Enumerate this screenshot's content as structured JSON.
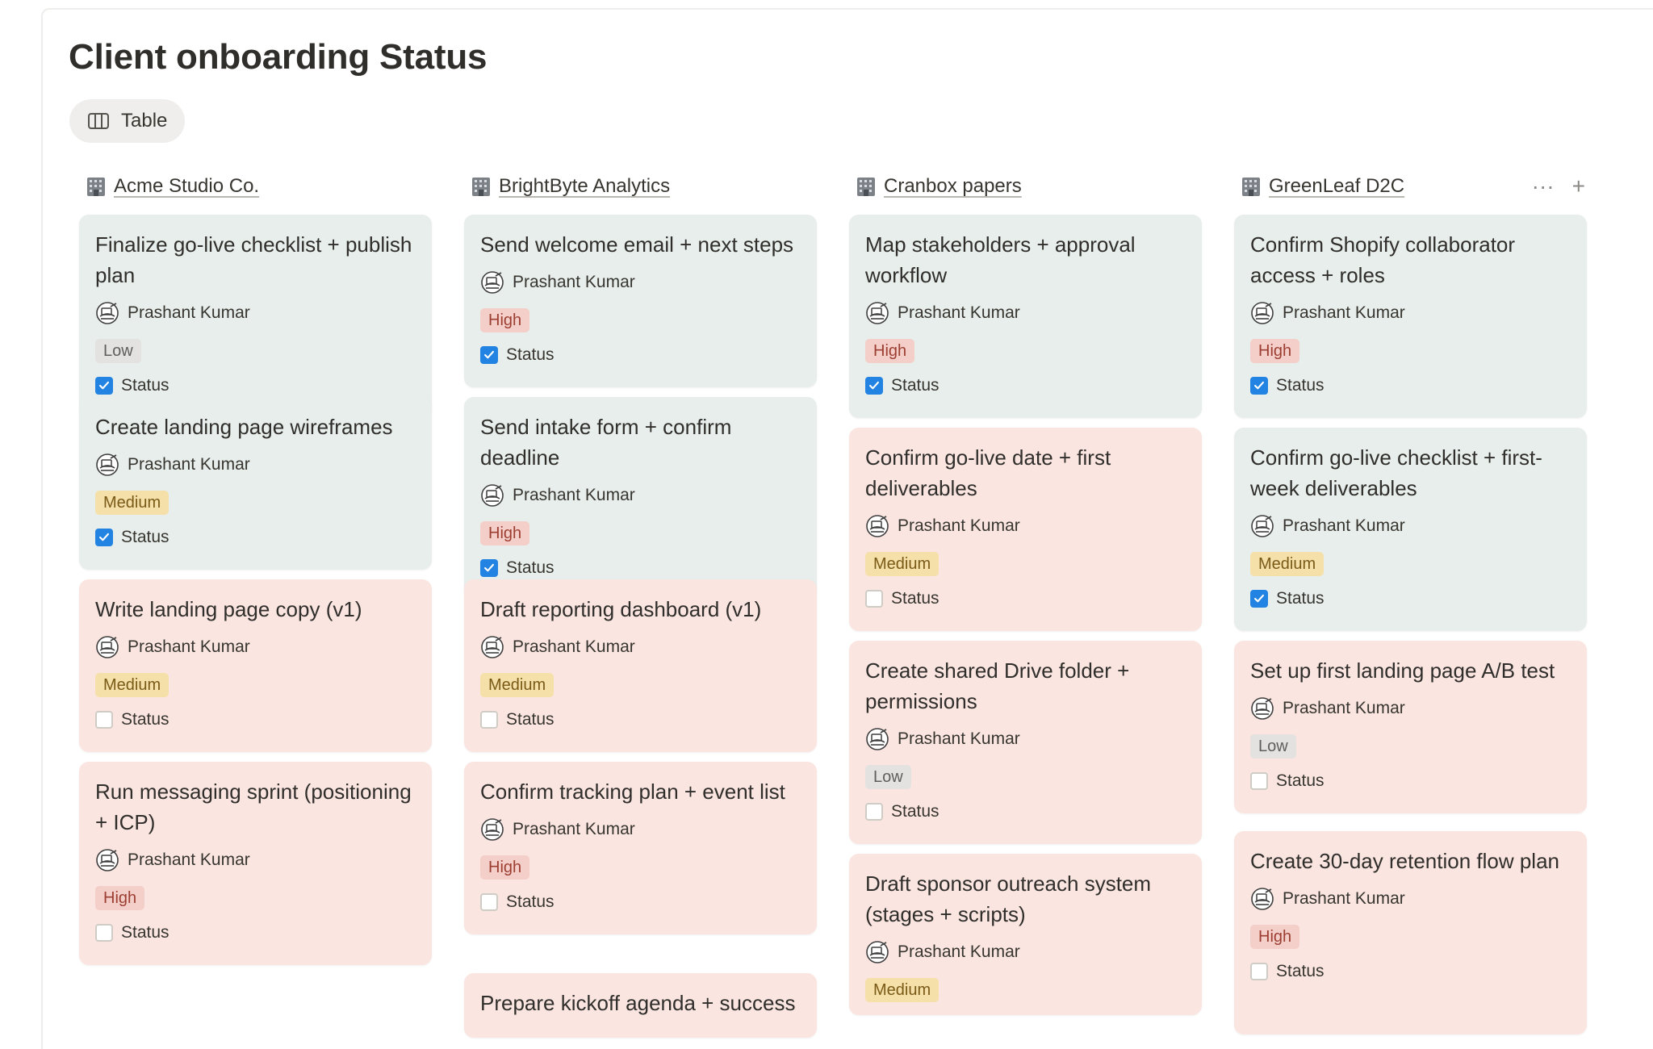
{
  "page": {
    "title": "Client onboarding Status",
    "view_label": "Table"
  },
  "columns": [
    {
      "name": "Acme Studio Co.",
      "cards": [
        {
          "title": "Finalize go-live checklist + publish plan",
          "assignee": "Prashant Kumar",
          "priority": "Low",
          "status_label": "Status",
          "done": true,
          "tone": "green"
        },
        {
          "title": "Create landing page wireframes",
          "assignee": "Prashant Kumar",
          "priority": "Medium",
          "status_label": "Status",
          "done": true,
          "tone": "green"
        },
        {
          "title": "Write landing page copy (v1)",
          "assignee": "Prashant Kumar",
          "priority": "Medium",
          "status_label": "Status",
          "done": false,
          "tone": "pink"
        },
        {
          "title": "Run messaging sprint (positioning + ICP)",
          "assignee": "Prashant Kumar",
          "priority": "High",
          "status_label": "Status",
          "done": false,
          "tone": "pink"
        }
      ]
    },
    {
      "name": "BrightByte Analytics",
      "cards": [
        {
          "title": "Send welcome email + next steps",
          "assignee": "Prashant Kumar",
          "priority": "High",
          "status_label": "Status",
          "done": true,
          "tone": "green"
        },
        {
          "title": "Send intake form + confirm deadline",
          "assignee": "Prashant Kumar",
          "priority": "High",
          "status_label": "Status",
          "done": true,
          "tone": "green"
        },
        {
          "title": "Draft reporting dashboard (v1)",
          "assignee": "Prashant Kumar",
          "priority": "Medium",
          "status_label": "Status",
          "done": false,
          "tone": "pink"
        },
        {
          "title": "Confirm tracking plan + event list",
          "assignee": "Prashant Kumar",
          "priority": "High",
          "status_label": "Status",
          "done": false,
          "tone": "pink"
        },
        {
          "title": "Prepare kickoff agenda + success",
          "assignee": "",
          "priority": "",
          "status_label": "",
          "done": false,
          "tone": "pink"
        }
      ]
    },
    {
      "name": "Cranbox papers",
      "cards": [
        {
          "title": "Map stakeholders + approval workflow",
          "assignee": "Prashant Kumar",
          "priority": "High",
          "status_label": "Status",
          "done": true,
          "tone": "green"
        },
        {
          "title": "Confirm go-live date + first deliverables",
          "assignee": "Prashant Kumar",
          "priority": "Medium",
          "status_label": "Status",
          "done": false,
          "tone": "pink"
        },
        {
          "title": "Create shared Drive folder + permissions",
          "assignee": "Prashant Kumar",
          "priority": "Low",
          "status_label": "Status",
          "done": false,
          "tone": "pink"
        },
        {
          "title": "Draft sponsor outreach system (stages + scripts)",
          "assignee": "Prashant Kumar",
          "priority": "Medium",
          "status_label": "",
          "done": false,
          "tone": "pink"
        }
      ]
    },
    {
      "name": "GreenLeaf D2C",
      "actions": {
        "more": "···",
        "add": "+"
      },
      "cards": [
        {
          "title": "Confirm Shopify collaborator access + roles",
          "assignee": "Prashant Kumar",
          "priority": "High",
          "status_label": "Status",
          "done": true,
          "tone": "green"
        },
        {
          "title": "Confirm go-live checklist + first-week deliverables",
          "assignee": "Prashant Kumar",
          "priority": "Medium",
          "status_label": "Status",
          "done": true,
          "tone": "green"
        },
        {
          "title": "Set up first landing page A/B test",
          "assignee": "Prashant Kumar",
          "priority": "Low",
          "status_label": "Status",
          "done": false,
          "tone": "pink"
        },
        {
          "title": "Create 30-day retention flow plan",
          "assignee": "Prashant Kumar",
          "priority": "High",
          "status_label": "Status",
          "done": false,
          "tone": "pink"
        }
      ]
    }
  ],
  "icons": {
    "view": "table-columns-icon",
    "column": "office-building-icon",
    "assignee": "person-at-desk-avatar-icon",
    "checkbox": "checkbox-icon"
  },
  "colors": {
    "green_card": "#e8eeec",
    "pink_card": "#fbe5e1",
    "checkbox": "#2383e2"
  }
}
